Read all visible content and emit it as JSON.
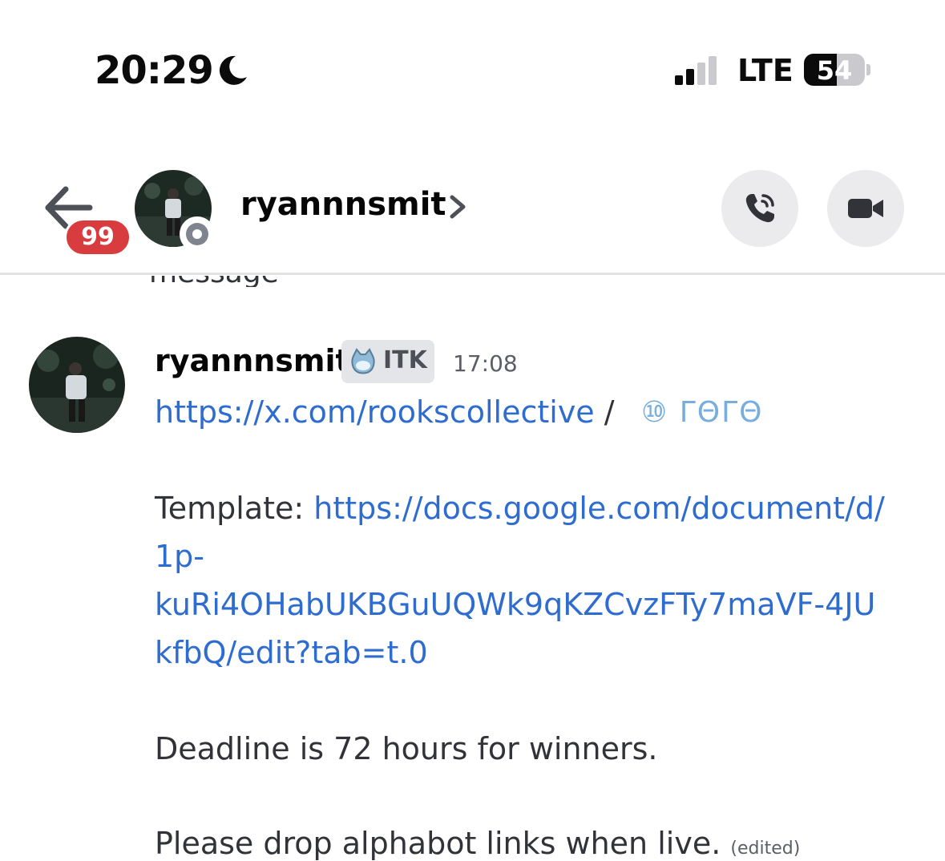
{
  "status_bar": {
    "time": "20:29",
    "network": "LTE",
    "battery": "54",
    "battery_level": 0.54
  },
  "header": {
    "back_badge": "99",
    "username": "ryannnsmit"
  },
  "clipped_text": "message",
  "message": {
    "author": "ryannnsmit",
    "tag": "ITK",
    "timestamp": "17:08",
    "link1": "https://x.com/rookscollective",
    "separator": " / ",
    "glyphs": "⑩ ΓΘΓΘ",
    "template_label": "Template: ",
    "template_link_lines": [
      "https://docs.google.com/document/d/",
      "1p-",
      "kuRi4OHabUKBGuUQWk9qKZCvzFTy7maVF-4JU",
      "kfbQ/edit?tab=t.0"
    ],
    "deadline": "Deadline is 72 hours for winners.",
    "please": "Please drop alphabot links when live.",
    "edited": "(edited)"
  },
  "colors": {
    "link": "#2e6ccf",
    "badge": "#d83c3e",
    "text": "#313338"
  },
  "icons": [
    "moon-icon",
    "signal-icon",
    "battery-icon",
    "back-arrow-icon",
    "chevron-right-icon",
    "phone-call-icon",
    "video-camera-icon",
    "itk-tag-icon"
  ]
}
